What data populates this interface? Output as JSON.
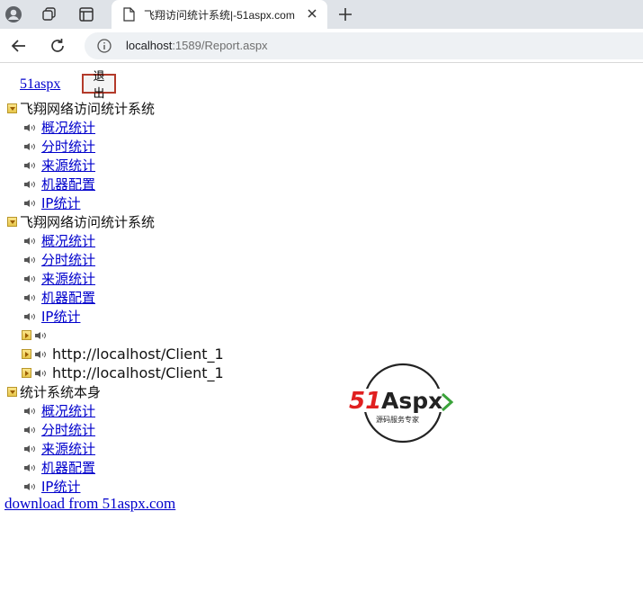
{
  "browser": {
    "tab_title": "飞翔访问统计系统|-51aspx.com",
    "url_host": "localhost",
    "url_rest": ":1589/Report.aspx"
  },
  "page": {
    "site_link": "51aspx",
    "logout_label": "退出",
    "groups": [
      {
        "label": "飞翔网络访问统计系统",
        "expanded": true,
        "items": [
          "概况统计",
          "分时统计",
          "来源统计",
          "机器配置",
          "IP统计"
        ]
      },
      {
        "label": "飞翔网络访问统计系统",
        "expanded": true,
        "items": [
          "概况统计",
          "分时统计",
          "来源统计",
          "机器配置",
          "IP统计"
        ],
        "sub_nodes": [
          "",
          "http://localhost/Client_1",
          "http://localhost/Client_1"
        ]
      },
      {
        "label": "统计系统本身",
        "expanded": true,
        "items": [
          "概况统计",
          "分时统计",
          "来源统计",
          "机器配置",
          "IP统计"
        ]
      }
    ],
    "footer_link": "download from 51aspx.com",
    "watermark": {
      "brand": "51Aspx",
      "tagline": "源码服务专家"
    }
  },
  "colors": {
    "link": "#0000cc",
    "logout_border": "#b33a2a",
    "watermark_red": "#e02020",
    "watermark_green": "#3aa33a"
  }
}
